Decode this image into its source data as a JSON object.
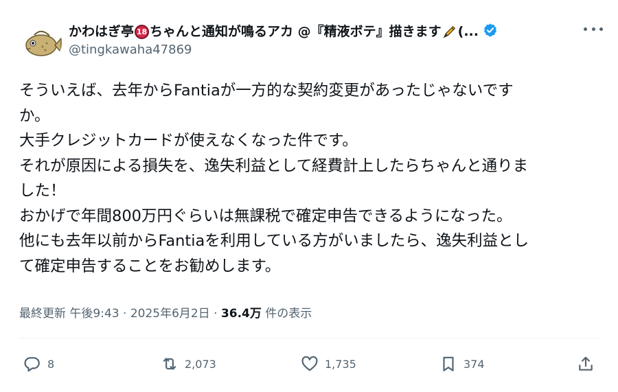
{
  "author": {
    "display_name_part1": "かわはぎ亭",
    "badge_text": "18",
    "display_name_part2": "ちゃんと通知が鳴るアカ @『精液ボテ』描きます",
    "display_name_suffix": "(...",
    "handle": "@tingkawaha47869",
    "avatar_icon": "fish-icon",
    "verified_icon": "verified-badge-icon"
  },
  "tweet": {
    "lines": [
      "そういえば、去年からFantiaが一方的な契約変更があったじゃないです",
      "か。",
      "大手クレジットカードが使えなくなった件です。",
      "それが原因による損失を、逸失利益として経費計上したらちゃんと通りま",
      "した！",
      "おかげで年間800万円ぐらいは無課税で確定申告できるようになった。",
      "他にも去年以前からFantiaを利用している方がいましたら、逸失利益とし",
      "て確定申告することをお勧めします。"
    ]
  },
  "meta": {
    "edited_label": "最終更新",
    "time": "午後9:43",
    "sep1": " · ",
    "date": "2025年6月2日",
    "sep2": " · ",
    "views_count": "36.4万",
    "views_label": "件の表示"
  },
  "actions": {
    "reply": {
      "icon": "reply-icon",
      "count": "8"
    },
    "retweet": {
      "icon": "retweet-icon",
      "count": "2,073"
    },
    "like": {
      "icon": "heart-icon",
      "count": "1,735"
    },
    "bookmark": {
      "icon": "bookmark-icon",
      "count": "374"
    },
    "share": {
      "icon": "share-icon"
    }
  },
  "colors": {
    "text": "#0f1419",
    "secondary": "#536471",
    "verified": "#1d9bf0",
    "badge": "#d6294b"
  }
}
